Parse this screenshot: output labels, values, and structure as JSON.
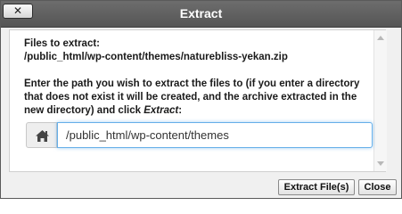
{
  "dialog": {
    "title": "Extract",
    "close_label": "✕"
  },
  "content": {
    "files_label": "Files to extract:",
    "files_path": "/public_html/wp-content/themes/naturebliss-yekan.zip",
    "instructions_prefix": "Enter the path you wish to extract the files to (if you enter a directory that does not exist it will be created, and the archive extracted in the new directory) and click ",
    "instructions_emphasis": "Extract",
    "instructions_suffix": ":",
    "home_icon": "home-icon",
    "path_value": "/public_html/wp-content/themes"
  },
  "footer": {
    "extract_label": "Extract File(s)",
    "cancel_label": "Close"
  }
}
